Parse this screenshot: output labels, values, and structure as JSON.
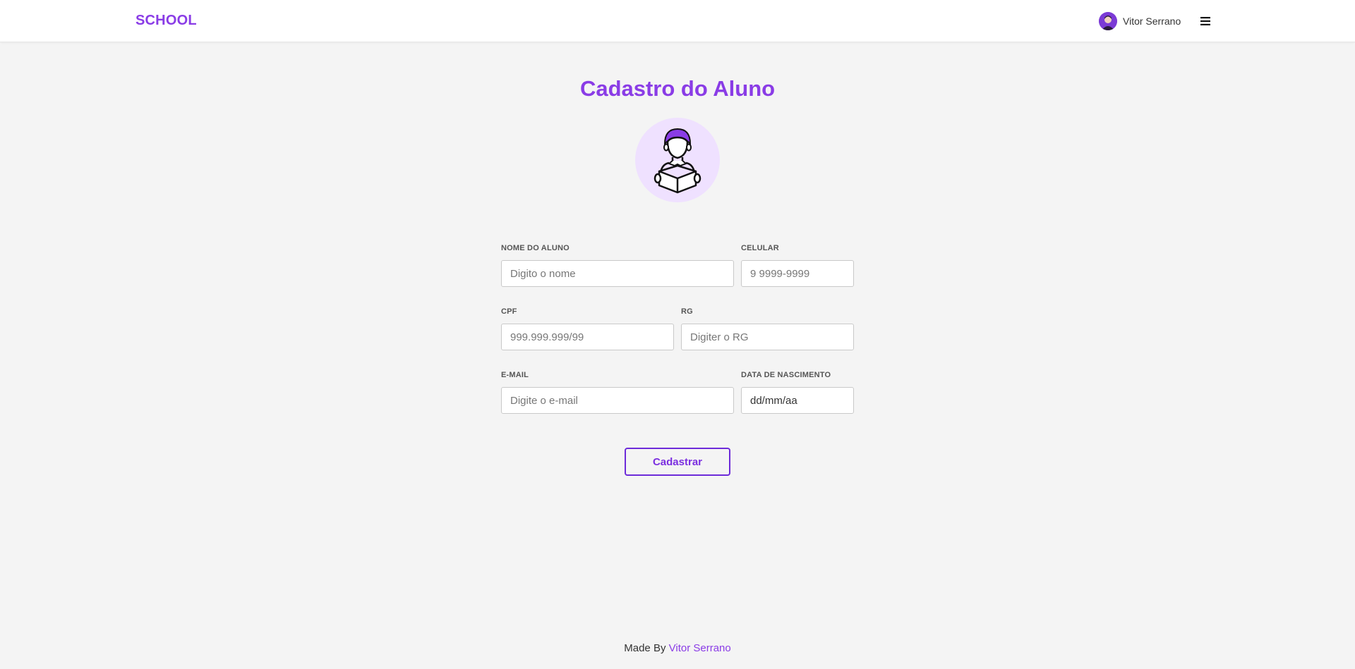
{
  "header": {
    "brand": "SCHOOL",
    "user_name": "Vitor Serrano"
  },
  "page": {
    "title": "Cadastro do Aluno"
  },
  "form": {
    "nome": {
      "label": "NOME DO ALUNO",
      "placeholder": "Digito o nome"
    },
    "celular": {
      "label": "CELULAR",
      "placeholder": "9 9999-9999"
    },
    "cpf": {
      "label": "CPF",
      "placeholder": "999.999.999/99"
    },
    "rg": {
      "label": "RG",
      "placeholder": "Digiter o RG"
    },
    "email": {
      "label": "E-MAIL",
      "placeholder": "Digite o e-mail"
    },
    "nascimento": {
      "label": "DATA DE NASCIMENTO",
      "value": "dd/mm/aa"
    },
    "submit_label": "Cadastrar"
  },
  "footer": {
    "prefix": "Made By",
    "author": "Vitor Serrano"
  },
  "icons": {
    "user_avatar": "avatar-icon",
    "menu": "hamburger-menu-icon",
    "student": "student-reading-icon"
  },
  "colors": {
    "accent": "#8a3ce6",
    "accent_dark": "#6d2bd9",
    "illustration_bg": "#efe1ff",
    "page_bg": "#f4f4f4"
  }
}
